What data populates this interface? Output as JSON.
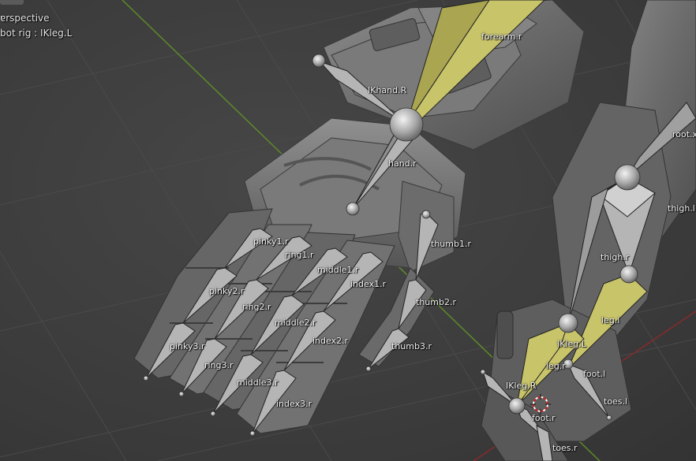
{
  "viewport": {
    "view_mode": "Perspective",
    "object_info": "bot rig : IKleg.L",
    "view_mode_display": "ɐrspective"
  },
  "colors": {
    "background": "#3d3d3d",
    "grid": "#4a4a4a",
    "axis_x": "#8a2a2a",
    "axis_y": "#5d8a2a",
    "mesh": "#6e6e6e",
    "bone_gray": "#b5b5b5",
    "bone_selected": "#c8c46a"
  },
  "bones": [
    {
      "key": "forearm_r",
      "label": "forearm.r"
    },
    {
      "key": "ikhand_r",
      "label": "IKhand.R"
    },
    {
      "key": "hand_r",
      "label": "hand.r"
    },
    {
      "key": "pinky1_r",
      "label": "pinky1.r"
    },
    {
      "key": "ring1_r",
      "label": "ring1.r"
    },
    {
      "key": "middle1_r",
      "label": "middle1.r"
    },
    {
      "key": "index1_r",
      "label": "index1.r"
    },
    {
      "key": "thumb1_r",
      "label": "thumb1.r"
    },
    {
      "key": "pinky2_r",
      "label": "pinky2.r"
    },
    {
      "key": "ring2_r",
      "label": "ring2.r"
    },
    {
      "key": "middle2_r",
      "label": "middle2.r"
    },
    {
      "key": "thumb2_r",
      "label": "thumb2.r"
    },
    {
      "key": "index2_r",
      "label": "index2.r"
    },
    {
      "key": "pinky3_r",
      "label": "pinky3.r"
    },
    {
      "key": "thumb3_r",
      "label": "thumb3.r"
    },
    {
      "key": "ring3_r",
      "label": "ring3.r"
    },
    {
      "key": "middle3_r",
      "label": "middle3.r"
    },
    {
      "key": "index3_r",
      "label": "index3.r"
    },
    {
      "key": "root_x",
      "label": "root.x"
    },
    {
      "key": "thigh_l",
      "label": "thigh.l"
    },
    {
      "key": "thigh_r",
      "label": "thigh.r"
    },
    {
      "key": "leg_l",
      "label": "leg.l"
    },
    {
      "key": "ikleg_l",
      "label": "IKleg.L"
    },
    {
      "key": "leg_r",
      "label": "leg.r"
    },
    {
      "key": "foot_l",
      "label": "foot.l"
    },
    {
      "key": "ikleg_r",
      "label": "IKleg.R"
    },
    {
      "key": "toes_l",
      "label": "toes.l"
    },
    {
      "key": "foot_r",
      "label": "foot.r"
    },
    {
      "key": "toes_r",
      "label": "toes.r"
    }
  ]
}
